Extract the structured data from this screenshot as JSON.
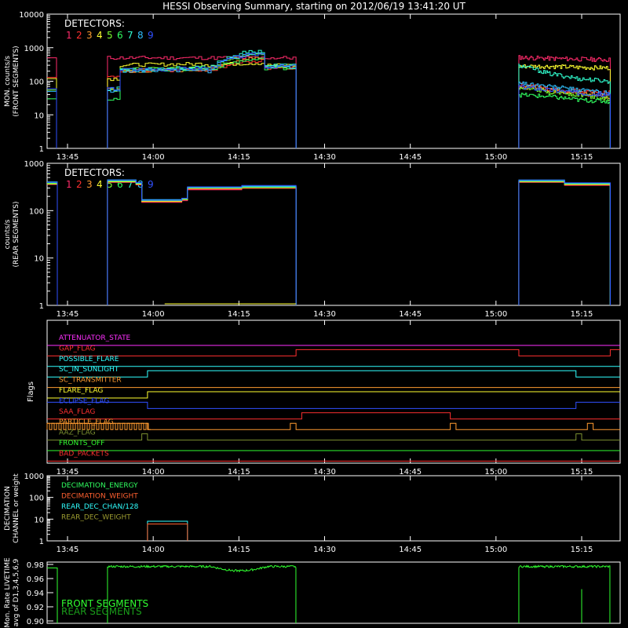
{
  "title": "HESSI Observing Summary, starting on 2012/06/19 13:41:20 UT",
  "colors": {
    "bg": "#000000",
    "axis": "#ffffff",
    "det": [
      "#ff2b6b",
      "#ff3030",
      "#ff9b30",
      "#ffff30",
      "#7cff30",
      "#30ff60",
      "#30ffd0",
      "#30c0ff",
      "#3050ff"
    ]
  },
  "chart_data": [
    {
      "id": "front",
      "type": "line",
      "ylabel": [
        "MON. counts/s",
        "(FRONT SEGMENTS)"
      ],
      "log": true,
      "ylim": [
        1,
        10000
      ],
      "yticks": [
        "10000",
        "1000",
        "100",
        "10",
        "1"
      ],
      "xticks": [
        "13:45",
        "14:00",
        "14:15",
        "14:30",
        "14:45",
        "15:00",
        "15:15"
      ],
      "legend_title": "DETECTORS:",
      "legend_items": [
        "1",
        "2",
        "3",
        "4",
        "5",
        "6",
        "7",
        "8",
        "9"
      ],
      "intervals": [
        [
          13.5,
          14.0,
          15.0
        ],
        [
          13.75,
          14.6,
          15.2
        ]
      ],
      "series": [
        {
          "name": "1",
          "seg1": [
            500,
            500,
            520,
            500
          ],
          "seg2": [
            520,
            480,
            460,
            440
          ]
        },
        {
          "name": "2",
          "seg1": [
            130,
            200,
            400,
            250
          ],
          "seg2": [
            80,
            60,
            50,
            45
          ]
        },
        {
          "name": "3",
          "seg1": [
            60,
            200,
            500,
            260
          ],
          "seg2": [
            70,
            55,
            45,
            35
          ]
        },
        {
          "name": "4",
          "seg1": [
            120,
            300,
            350,
            300
          ],
          "seg2": [
            280,
            280,
            260,
            250
          ]
        },
        {
          "name": "5",
          "seg1": [
            55,
            220,
            600,
            270
          ],
          "seg2": [
            60,
            50,
            40,
            30
          ]
        },
        {
          "name": "6",
          "seg1": [
            30,
            210,
            450,
            250
          ],
          "seg2": [
            40,
            35,
            28,
            25
          ]
        },
        {
          "name": "7",
          "seg1": [
            60,
            230,
            800,
            300
          ],
          "seg2": [
            300,
            170,
            120,
            100
          ]
        },
        {
          "name": "8",
          "seg1": [
            50,
            200,
            700,
            260
          ],
          "seg2": [
            90,
            70,
            55,
            45
          ]
        },
        {
          "name": "9",
          "seg1": [
            60,
            220,
            650,
            280
          ],
          "seg2": [
            70,
            55,
            45,
            40
          ]
        }
      ]
    },
    {
      "id": "rear",
      "type": "line",
      "ylabel": [
        "counts/s",
        "(REAR SEGMENTS)"
      ],
      "log": true,
      "ylim": [
        1,
        1000
      ],
      "yticks": [
        "1000",
        "100",
        "10",
        "1"
      ],
      "xticks": [
        "13:45",
        "14:00",
        "14:15",
        "14:30",
        "14:45",
        "15:00",
        "15:15"
      ],
      "legend_title": "DETECTORS:",
      "legend_items": [
        "1",
        "2",
        "3",
        "4",
        "5",
        "6",
        "7",
        "8",
        "9"
      ],
      "values": {
        "pre": 380,
        "block_a": 420,
        "block_b": 160,
        "block_c": 300,
        "block_d": 420
      }
    },
    {
      "id": "flags",
      "type": "line",
      "ylabel": [
        "Flags"
      ],
      "xticks": [
        "13:45",
        "14:00",
        "14:15",
        "14:30",
        "14:45",
        "15:00",
        "15:15"
      ],
      "flags": [
        {
          "label": "ATTENUATOR_STATE",
          "color": "#ff30ff"
        },
        {
          "label": "GAP_FLAG",
          "color": "#ff3030"
        },
        {
          "label": "POSSIBLE_FLARE",
          "color": "#30ffff"
        },
        {
          "label": "SC_IN_SUNLIGHT",
          "color": "#30ffff"
        },
        {
          "label": "SC_TRANSMITTER",
          "color": "#ff9b30"
        },
        {
          "label": "FLARE_FLAG",
          "color": "#ffff30"
        },
        {
          "label": "ECLIPSE_FLAG",
          "color": "#3050ff"
        },
        {
          "label": "SAA_FLAG",
          "color": "#ff3030"
        },
        {
          "label": "PARTICLE_FLAG",
          "color": "#ff9b30"
        },
        {
          "label": "AAZ_FLAG",
          "color": "#7c9030"
        },
        {
          "label": "FRONTS_OFF",
          "color": "#30ff30"
        },
        {
          "label": "BAD_PACKETS",
          "color": "#ff3030"
        }
      ]
    },
    {
      "id": "decimation",
      "type": "line",
      "ylabel": [
        "DECIMATION",
        "CHANNEL or weight"
      ],
      "log": true,
      "ylim": [
        1,
        1000
      ],
      "yticks": [
        "1000",
        "100",
        "10",
        "1"
      ],
      "xticks": [
        "13:45",
        "14:00",
        "14:15",
        "14:30",
        "14:45",
        "15:00",
        "15:15"
      ],
      "legend": [
        {
          "label": "DECIMATION_ENERGY",
          "color": "#30ff60"
        },
        {
          "label": "DECIMATION_WEIGHT",
          "color": "#ff6030"
        },
        {
          "label": "REAR_DEC_CHAN/128",
          "color": "#30ffff"
        },
        {
          "label": "REAR_DEC_WEIGHT",
          "color": "#9b9b30"
        }
      ],
      "step": {
        "from": "13:59",
        "to": "14:06",
        "chan": 8,
        "weight": 6
      }
    },
    {
      "id": "livetime",
      "type": "line",
      "ylabel": [
        "Mon. Rate LIVETIME",
        "avg of D1,3,4,5,6,9"
      ],
      "ylim": [
        0.9,
        0.98
      ],
      "yticks": [
        "0.98",
        "0.96",
        "0.94",
        "0.92",
        "0.90"
      ],
      "legend": [
        {
          "label": "FRONT SEGMENTS",
          "color": "#30ff30"
        },
        {
          "label": "REAR SEGMENTS",
          "color": "#1a9e1a"
        }
      ],
      "front_level": 0.977
    }
  ]
}
